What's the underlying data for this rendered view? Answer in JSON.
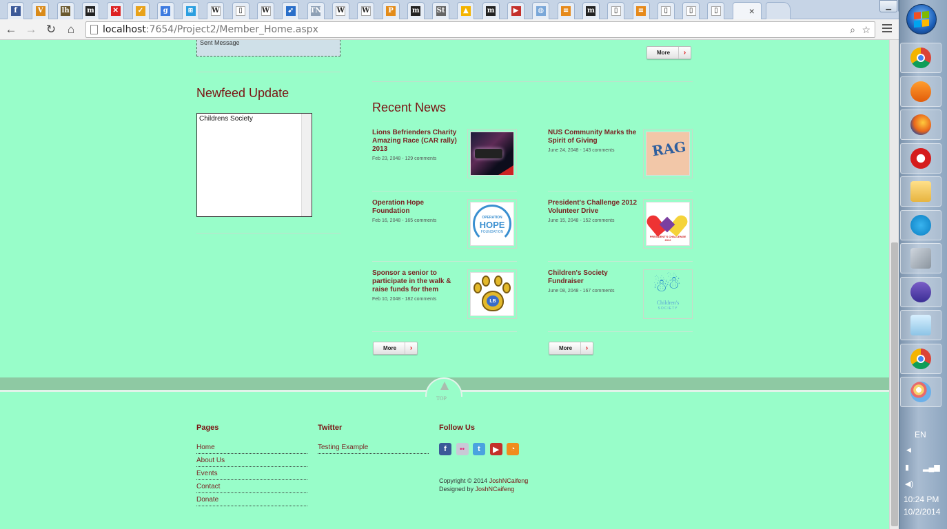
{
  "browser": {
    "tabs": [
      {
        "icon": "facebook-icon",
        "glyph": "f",
        "color": "#3b5998"
      },
      {
        "icon": "v-icon",
        "glyph": "V",
        "color": "#d98b1b"
      },
      {
        "icon": "lh-icon",
        "glyph": "lh",
        "color": "#6b5a2f"
      },
      {
        "icon": "m-icon",
        "glyph": "m",
        "color": "#222"
      },
      {
        "icon": "x-icon",
        "glyph": "✕",
        "color": "#d22"
      },
      {
        "icon": "check-icon",
        "glyph": "✓",
        "color": "#e8a21a"
      },
      {
        "icon": "google-icon",
        "glyph": "g",
        "color": "#3d7be0"
      },
      {
        "icon": "windows-icon",
        "glyph": "⊞",
        "color": "#2b9fe0"
      },
      {
        "icon": "wikipedia-icon",
        "glyph": "W",
        "color": "#fff"
      },
      {
        "icon": "page-icon",
        "glyph": "▯",
        "color": "#fff"
      },
      {
        "icon": "wikipedia-icon",
        "glyph": "W",
        "color": "#fff"
      },
      {
        "icon": "bird-icon",
        "glyph": "➹",
        "color": "#2a6fc9"
      },
      {
        "icon": "tn-icon",
        "glyph": "TN",
        "color": "#8ea0b5"
      },
      {
        "icon": "wikipedia-icon",
        "glyph": "W",
        "color": "#fff"
      },
      {
        "icon": "wikipedia-icon",
        "glyph": "W",
        "color": "#fff"
      },
      {
        "icon": "p-icon",
        "glyph": "P",
        "color": "#e38c1a"
      },
      {
        "icon": "m-icon",
        "glyph": "m",
        "color": "#222"
      },
      {
        "icon": "st-icon",
        "glyph": "St",
        "color": "#666"
      },
      {
        "icon": "drive-icon",
        "glyph": "▲",
        "color": "#f4b400"
      },
      {
        "icon": "m-icon",
        "glyph": "m",
        "color": "#222"
      },
      {
        "icon": "youtube-icon",
        "glyph": "▶",
        "color": "#c4302b"
      },
      {
        "icon": "globe-icon",
        "glyph": "◍",
        "color": "#7aa7d8"
      },
      {
        "icon": "stack-icon",
        "glyph": "≡",
        "color": "#e68a1b"
      },
      {
        "icon": "m-icon",
        "glyph": "m",
        "color": "#222"
      },
      {
        "icon": "page-icon",
        "glyph": "▯",
        "color": "#fff"
      },
      {
        "icon": "stack-icon",
        "glyph": "≡",
        "color": "#e68a1b"
      },
      {
        "icon": "page-icon",
        "glyph": "▯",
        "color": "#fff"
      },
      {
        "icon": "page-icon",
        "glyph": "▯",
        "color": "#fff"
      },
      {
        "icon": "page-icon",
        "glyph": "▯",
        "color": "#fff"
      }
    ],
    "active_tab_close": "×",
    "url_host": "localhost",
    "url_rest": ":7654/Project2/Member_Home.aspx"
  },
  "sidebar": {
    "sent_message": "Sent Message",
    "newsfeed_title": "Newfeed Update",
    "newsfeed_item": "Childrens Society"
  },
  "main": {
    "top_more_label": "More",
    "recent_news_title": "Recent News",
    "news": [
      {
        "title": "Lions Befrienders Charity Amazing Race (CAR rally) 2013",
        "meta": "Feb 23, 2048 - 129 comments",
        "image": "car-rally-photo"
      },
      {
        "title": "NUS Community Marks the Spirit of Giving",
        "meta": "June 24, 2048 - 143 comments",
        "image": "rag-logo"
      },
      {
        "title": "Operation Hope Foundation",
        "meta": "Feb 16, 2048 - 165 comments",
        "image": "operation-hope-logo",
        "logo_line1": "OPERATION",
        "logo_line2": "HOPE",
        "logo_line3": "FOUNDATION"
      },
      {
        "title": "President's Challenge 2012 Volunteer Drive",
        "meta": "June 15, 2048 - 152 comments",
        "image": "presidents-challenge-logo",
        "logo_text": "PRESIDENT'S CHALLENGE 2012"
      },
      {
        "title": "Sponsor a senior to participate in the walk & raise funds for them",
        "meta": "Feb 10, 2048 - 182 comments",
        "image": "paw-logo",
        "logo_text": "LB"
      },
      {
        "title": "Children's Society Fundraiser",
        "meta": "June 08, 2048 - 167 comments",
        "image": "childrens-society-logo",
        "logo_line1": "Children's",
        "logo_line2": "SOCIETY"
      }
    ],
    "more_left": "More",
    "more_right": "More"
  },
  "footer": {
    "top_label": "TOP",
    "pages_title": "Pages",
    "pages": [
      "Home",
      "About Us",
      "Events",
      "Contact",
      "Donate"
    ],
    "twitter_title": "Twitter",
    "twitter_item": "Testing Example",
    "follow_title": "Follow Us",
    "social": [
      {
        "icon": "facebook-icon",
        "glyph": "f",
        "color": "#3b5998"
      },
      {
        "icon": "flickr-icon",
        "glyph": "••",
        "color": "#c9c9d6"
      },
      {
        "icon": "twitter-icon",
        "glyph": "t",
        "color": "#4aa3df"
      },
      {
        "icon": "youtube-icon",
        "glyph": "▶",
        "color": "#c4302b"
      },
      {
        "icon": "rss-icon",
        "glyph": "◔",
        "color": "#f08c1e"
      }
    ],
    "copyright_prefix": "Copyright © 2014 ",
    "copyright_name": "JoshNCaifeng",
    "designed_prefix": "Designed by ",
    "designed_name": "JoshNCaifeng"
  },
  "taskbar": {
    "apps": [
      {
        "icon": "chrome-icon"
      },
      {
        "icon": "media-player-icon"
      },
      {
        "icon": "firefox-icon"
      },
      {
        "icon": "opera-icon"
      },
      {
        "icon": "file-explorer-icon"
      },
      {
        "icon": "skype-icon"
      },
      {
        "icon": "tools-icon"
      },
      {
        "icon": "visual-studio-icon"
      },
      {
        "icon": "notepad-icon"
      },
      {
        "icon": "chrome-icon"
      },
      {
        "icon": "paint-icon"
      }
    ],
    "lang": "EN",
    "time": "10:24 PM",
    "date": "10/2/2014"
  }
}
